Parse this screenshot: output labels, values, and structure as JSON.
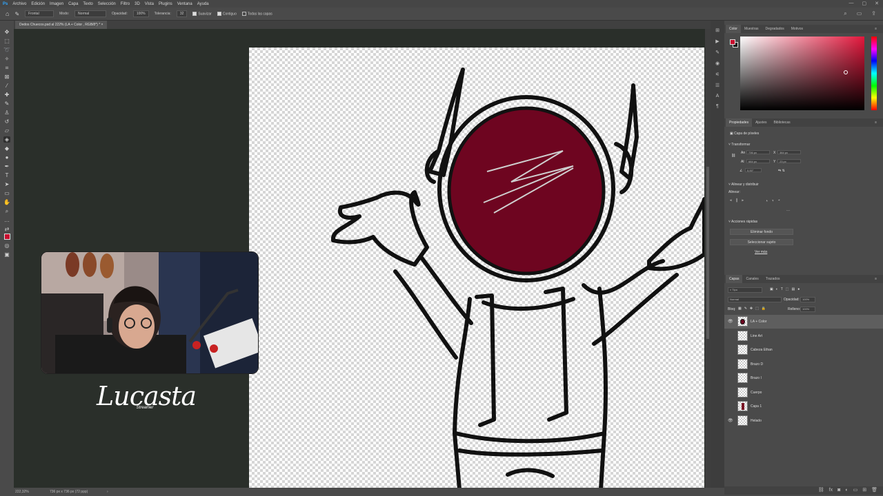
{
  "menu": {
    "items": [
      "Archivo",
      "Edición",
      "Imagen",
      "Capa",
      "Texto",
      "Selección",
      "Filtro",
      "3D",
      "Vista",
      "Plugins",
      "Ventana",
      "Ayuda"
    ]
  },
  "options": {
    "brush_preset": "Frontal",
    "mode_label": "Modo:",
    "mode_value": "Normal",
    "opacity_label": "Opacidad:",
    "opacity_value": "100%",
    "tolerance_label": "Tolerancia:",
    "tolerance_value": "32",
    "smooth_label": "Suavizar",
    "contiguous_label": "Contiguo",
    "all_layers_label": "Todas las capas"
  },
  "document": {
    "tab_title": "Dedos Chuecos.psd al 222% (LA + Color , RGB/8*) *"
  },
  "status": {
    "zoom": "222,32%",
    "doc_info": "736 px x 736 px (72 ppp)"
  },
  "streamer": {
    "name": "Lucasta",
    "tagline": "Streamer"
  },
  "color_panel": {
    "tabs": [
      "Color",
      "Muestras",
      "Degradados",
      "Motivos"
    ],
    "active_tab": "Color",
    "foreground": "#c80c2e",
    "background": "#111111"
  },
  "properties_panel": {
    "tabs": [
      "Propiedades",
      "Ajustes",
      "Bibliotecas"
    ],
    "layer_type": "Capa de píxeles",
    "transform_label": "Transformar",
    "w_value": "736 px",
    "x_value": "384 px",
    "h_value": "684 px",
    "y_value": "23 px",
    "angle_value": "0,00°",
    "align_label": "Alinear y distribuir",
    "align_sub": "Alinear:",
    "quick_actions_label": "Acciones rápidas",
    "btn_remove_bg": "Eliminar fondo",
    "btn_select_subject": "Seleccionar sujeto",
    "see_more": "Ver más"
  },
  "layers_panel": {
    "tabs": [
      "Capas",
      "Canales",
      "Trazados"
    ],
    "filter_label": "Tipo",
    "blend_mode": "Normal",
    "opacity_label": "Opacidad:",
    "opacity_value": "100%",
    "lock_label": "Bloq:",
    "fill_label": "Relleno:",
    "fill_value": "100%",
    "layers": [
      {
        "name": "LA + Color",
        "visible": true,
        "selected": true
      },
      {
        "name": "Line Art",
        "visible": false,
        "selected": false
      },
      {
        "name": "Cabeza Ethan",
        "visible": false,
        "selected": false
      },
      {
        "name": "Brazo D",
        "visible": false,
        "selected": false
      },
      {
        "name": "Brazo I",
        "visible": false,
        "selected": false
      },
      {
        "name": "Cuerpo",
        "visible": false,
        "selected": false
      },
      {
        "name": "Capa 1",
        "visible": false,
        "selected": false
      },
      {
        "name": "Helado",
        "visible": true,
        "selected": false
      }
    ]
  }
}
